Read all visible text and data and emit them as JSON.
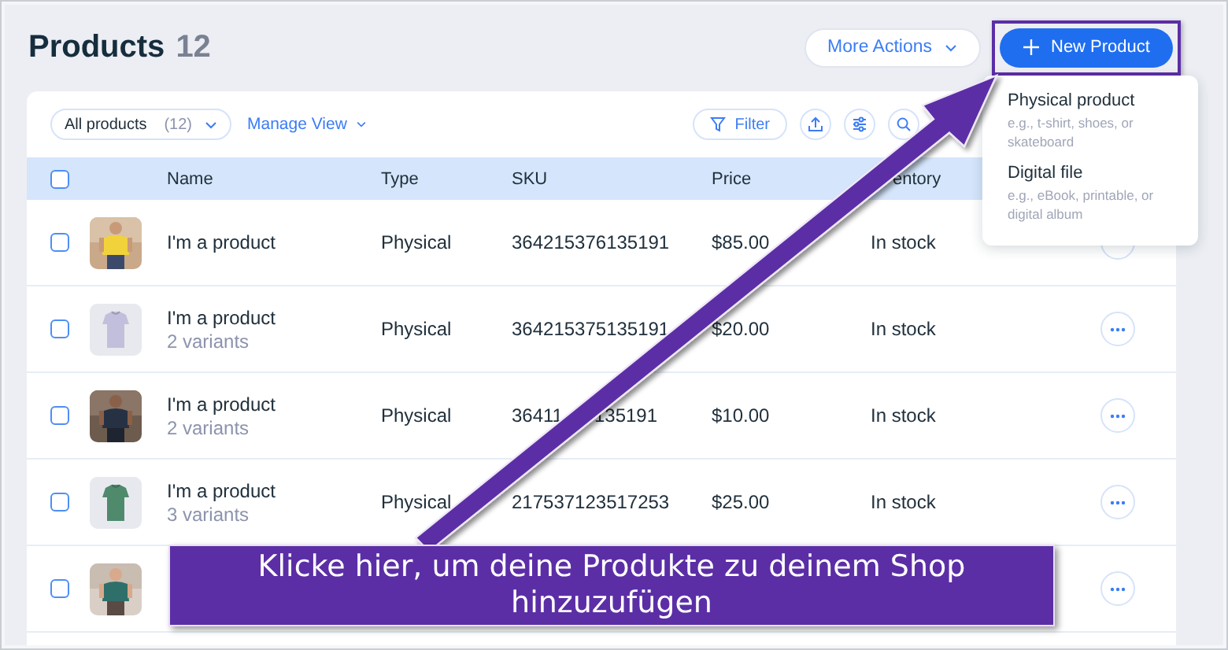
{
  "header": {
    "title": "Products",
    "count": "12"
  },
  "actions": [
    {
      "label": "More Actions",
      "kind": "secondary",
      "highlighted": false
    },
    {
      "label": "New Product",
      "kind": "primary",
      "highlighted": true
    }
  ],
  "menu": {
    "items": [
      {
        "title": "Physical product",
        "description": "e.g., t-shirt, shoes, or skateboard"
      },
      {
        "title": "Digital file",
        "description": "e.g., eBook, printable, or digital album"
      }
    ]
  },
  "toolbar": {
    "view": {
      "label": "All products",
      "count": "(12)"
    },
    "manage_view": "Manage View",
    "filter": "Filter"
  },
  "table": {
    "header_checked": false,
    "columns": [
      "Name",
      "Type",
      "SKU",
      "Price",
      "entory"
    ],
    "rows": [
      {
        "checked": false,
        "name": "I'm a product",
        "type": "Physical",
        "sku": "364215376135191",
        "price": "$85.00",
        "inventory": "In stock"
      },
      {
        "checked": false,
        "name": "I'm a product",
        "variants": "2 variants",
        "type": "Physical",
        "sku": "364215375135191",
        "price": "$20.00",
        "inventory": "In stock"
      },
      {
        "checked": false,
        "name": "I'm a product",
        "variants": "2 variants",
        "type": "Physical",
        "sku": [
          "36411",
          "135191"
        ],
        "price": "$10.00",
        "inventory": "In stock"
      },
      {
        "checked": false,
        "name": "I'm a product",
        "variants": "3 variants",
        "type": "Physical",
        "sku": "217537123517253",
        "price": "$25.00",
        "inventory": "In stock"
      },
      {
        "checked": false
      }
    ]
  },
  "annotation": {
    "text": "Klicke hier, um deine Produkte zu deinem Shop hinzuzufügen"
  }
}
